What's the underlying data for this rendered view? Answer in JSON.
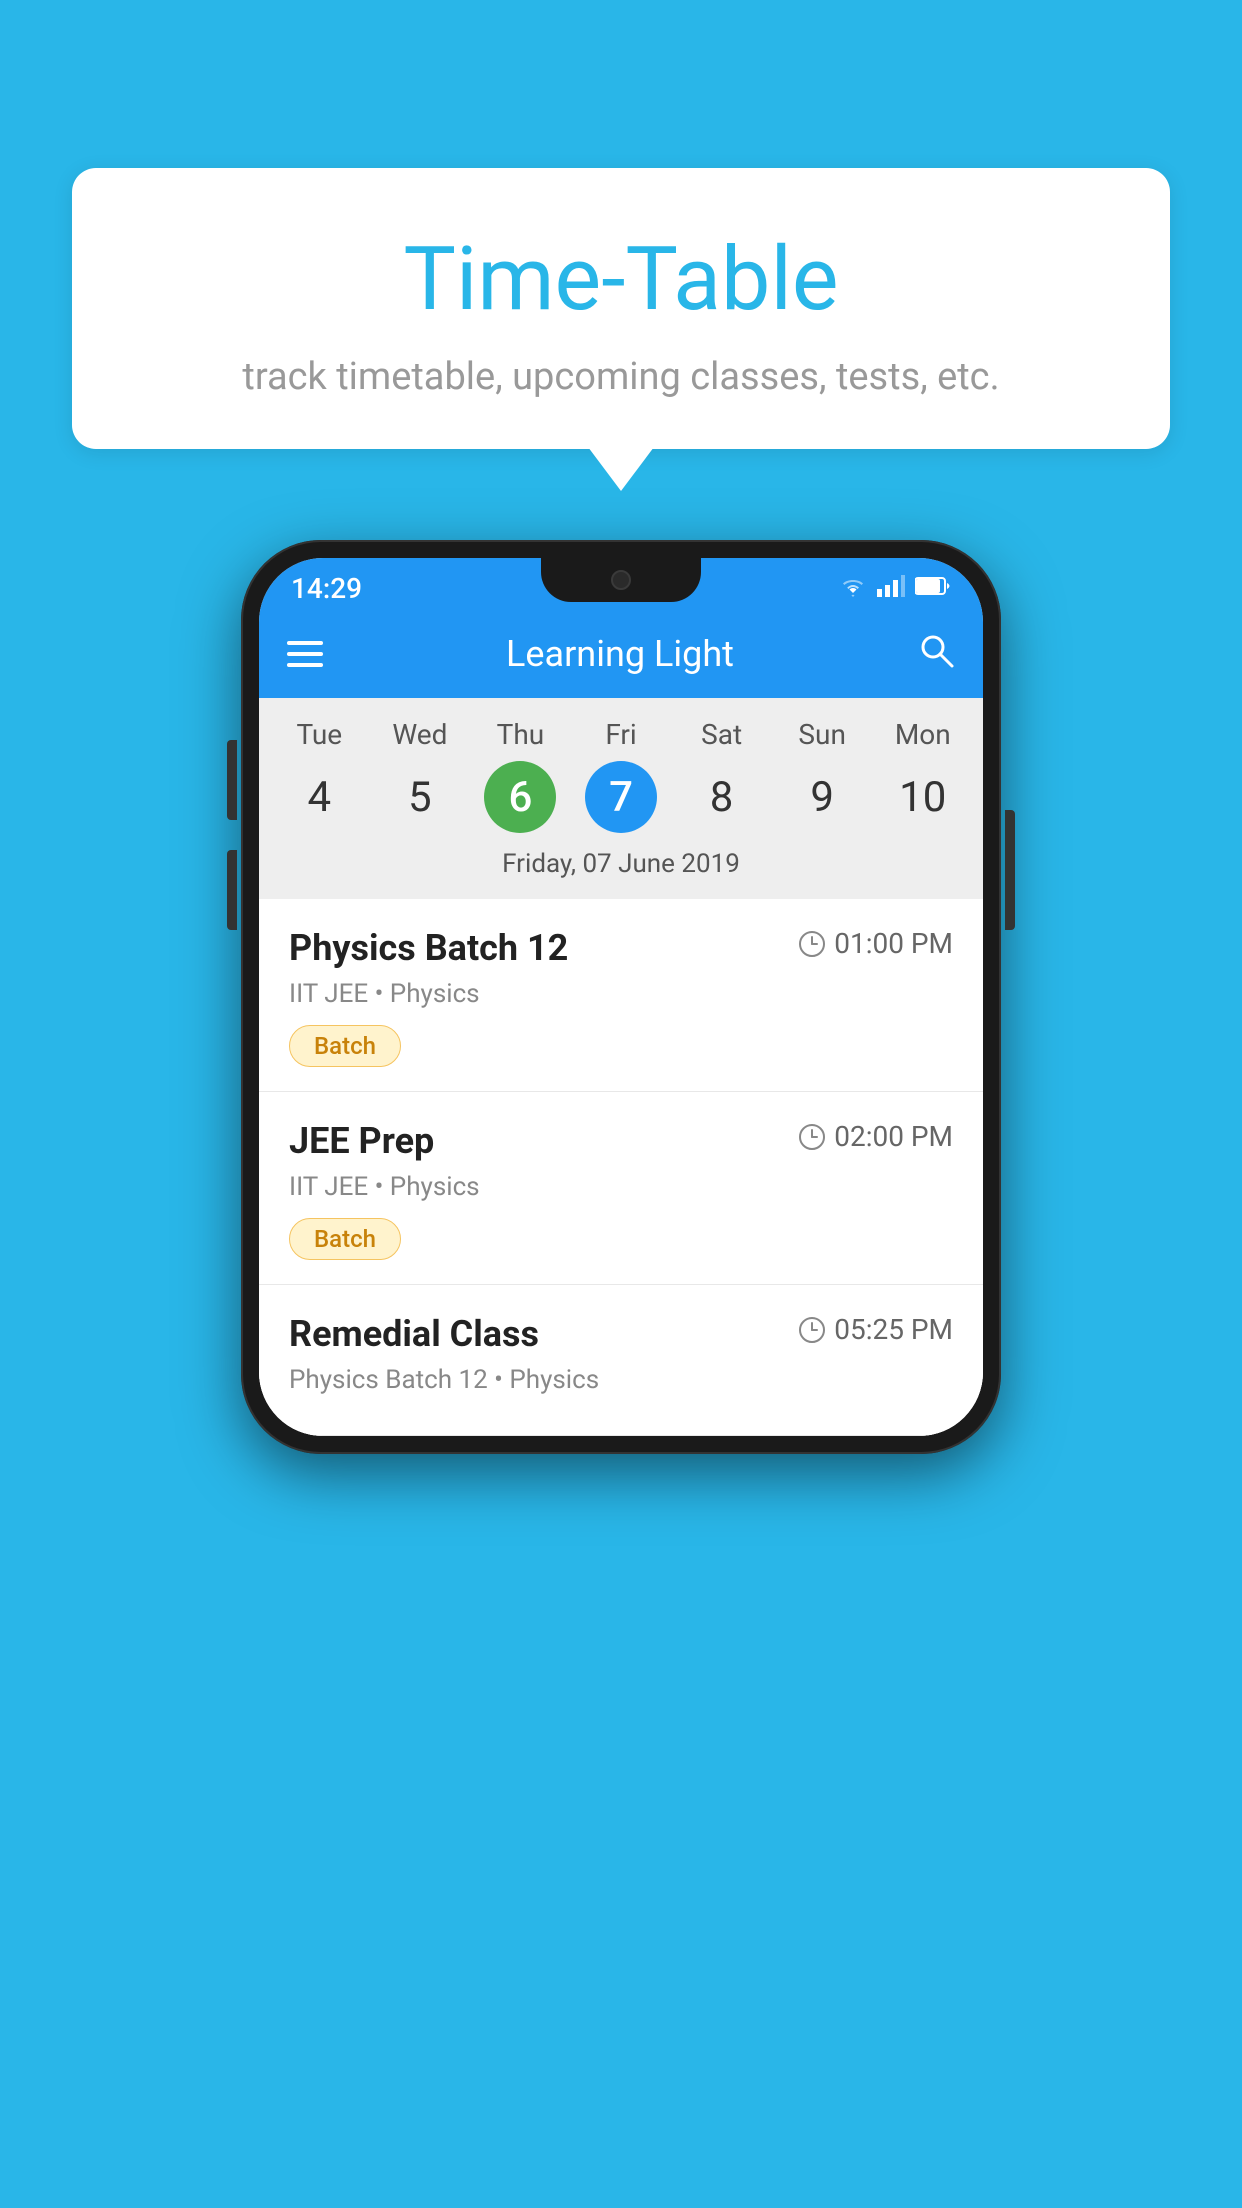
{
  "background_color": "#29b6e8",
  "bubble": {
    "title": "Time-Table",
    "subtitle": "track timetable, upcoming classes, tests, etc."
  },
  "app": {
    "name": "Learning Light",
    "status_bar": {
      "time": "14:29",
      "icons": [
        "wifi",
        "signal",
        "battery"
      ]
    }
  },
  "calendar": {
    "days": [
      {
        "name": "Tue",
        "number": "4",
        "state": "normal"
      },
      {
        "name": "Wed",
        "number": "5",
        "state": "normal"
      },
      {
        "name": "Thu",
        "number": "6",
        "state": "today"
      },
      {
        "name": "Fri",
        "number": "7",
        "state": "selected"
      },
      {
        "name": "Sat",
        "number": "8",
        "state": "normal"
      },
      {
        "name": "Sun",
        "number": "9",
        "state": "normal"
      },
      {
        "name": "Mon",
        "number": "10",
        "state": "normal"
      }
    ],
    "selected_date_label": "Friday, 07 June 2019"
  },
  "schedule": [
    {
      "title": "Physics Batch 12",
      "time": "01:00 PM",
      "meta": "IIT JEE • Physics",
      "tag": "Batch"
    },
    {
      "title": "JEE Prep",
      "time": "02:00 PM",
      "meta": "IIT JEE • Physics",
      "tag": "Batch"
    },
    {
      "title": "Remedial Class",
      "time": "05:25 PM",
      "meta": "Physics Batch 12 • Physics",
      "tag": ""
    }
  ],
  "icons": {
    "hamburger": "≡",
    "search": "🔍",
    "clock": "🕐"
  }
}
